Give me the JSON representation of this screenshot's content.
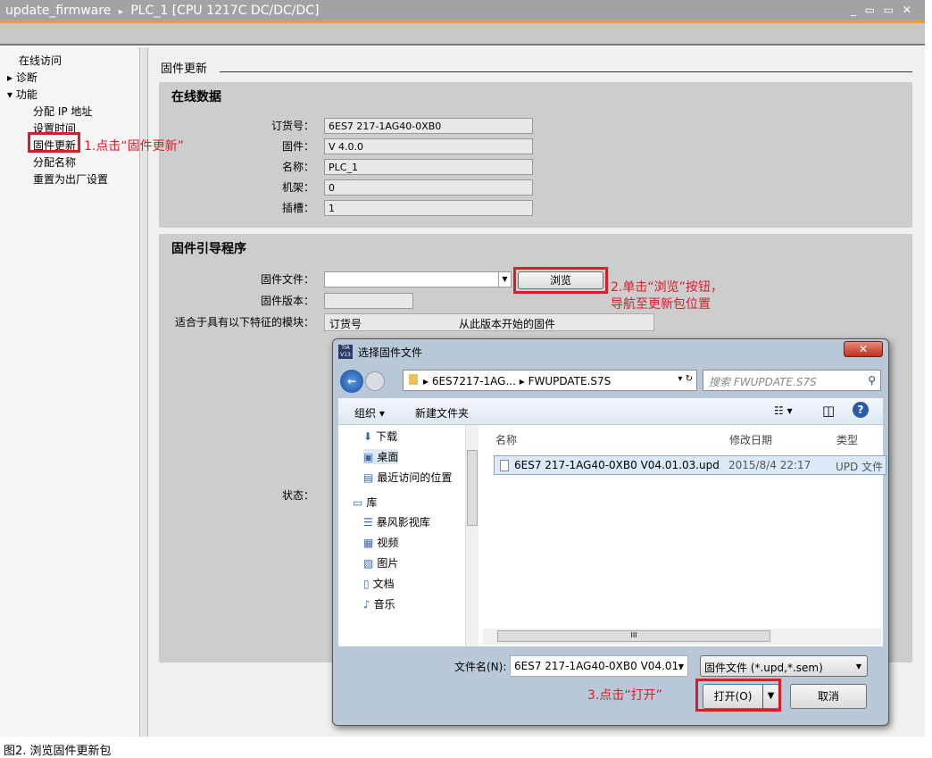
{
  "titlebar": {
    "breadcrumb_project": "update_firmware",
    "breadcrumb_sep": "▸",
    "breadcrumb_device": "PLC_1 [CPU 1217C DC/DC/DC]",
    "window_controls": "_ ▭ ▭ ✕"
  },
  "nav": {
    "items": [
      {
        "label": "在线访问",
        "level": 0
      },
      {
        "label": "诊断",
        "level": 0,
        "arrow": "▸"
      },
      {
        "label": "功能",
        "level": 0,
        "arrow": "▾"
      },
      {
        "label": "分配 IP 地址",
        "level": 1
      },
      {
        "label": "设置时间",
        "level": 1
      },
      {
        "label": "固件更新",
        "level": 1,
        "selected": true
      },
      {
        "label": "分配名称",
        "level": 1
      },
      {
        "label": "重置为出厂设置",
        "level": 1
      }
    ]
  },
  "main": {
    "header": "固件更新",
    "online": {
      "title": "在线数据",
      "fields": [
        {
          "label": "订货号：",
          "value": "6ES7 217-1AG40-0XB0"
        },
        {
          "label": "固件：",
          "value": "V 4.0.0"
        },
        {
          "label": "名称：",
          "value": "PLC_1"
        },
        {
          "label": "机架：",
          "value": "0"
        },
        {
          "label": "插槽：",
          "value": "1"
        }
      ]
    },
    "loader": {
      "title": "固件引导程序",
      "file_label": "固件文件：",
      "file_value": "",
      "browse": "浏览",
      "version_label": "固件版本：",
      "suitable_label": "适合于具有以下特征的模块：",
      "col_order": "订货号",
      "col_fw": "从此版本开始的固件",
      "status_label": "状态："
    }
  },
  "annotations": {
    "step1": "1.点击“固件更新”",
    "step2a": "2.单击“浏览”按钮，",
    "step2b": "导航至更新包位置",
    "step3": "3.点击“打开”",
    "accent": "#d4202a"
  },
  "dialog": {
    "title": "选择固件文件",
    "app_icon": "TIA V13",
    "path": [
      "6ES7217-1AG...",
      "FWUPDATE.S7S"
    ],
    "search_placeholder": "搜索 FWUPDATE.S7S",
    "organize": "组织 ▾",
    "new_folder": "新建文件夹",
    "tree": [
      {
        "label": "下载",
        "icon": "download"
      },
      {
        "label": "桌面",
        "icon": "desktop",
        "selected": true
      },
      {
        "label": "最近访问的位置",
        "icon": "recent"
      },
      {
        "label": "库",
        "icon": "library",
        "group": true
      },
      {
        "label": "暴风影视库",
        "icon": "video-library"
      },
      {
        "label": "视频",
        "icon": "film"
      },
      {
        "label": "图片",
        "icon": "picture"
      },
      {
        "label": "文档",
        "icon": "document"
      },
      {
        "label": "音乐",
        "icon": "music"
      }
    ],
    "columns": [
      "名称",
      "修改日期",
      "类型"
    ],
    "files": [
      {
        "name": "6ES7 217-1AG40-0XB0 V04.01.03.upd",
        "date": "2015/8/4 22:17",
        "type": "UPD 文件"
      }
    ],
    "filename_label": "文件名(N):",
    "filename_value": "6ES7 217-1AG40-0XB0 V04.01.",
    "filter": "固件文件 (*.upd,*.sem)",
    "open": "打开(O)",
    "cancel": "取消"
  },
  "caption": "图2. 浏览固件更新包"
}
